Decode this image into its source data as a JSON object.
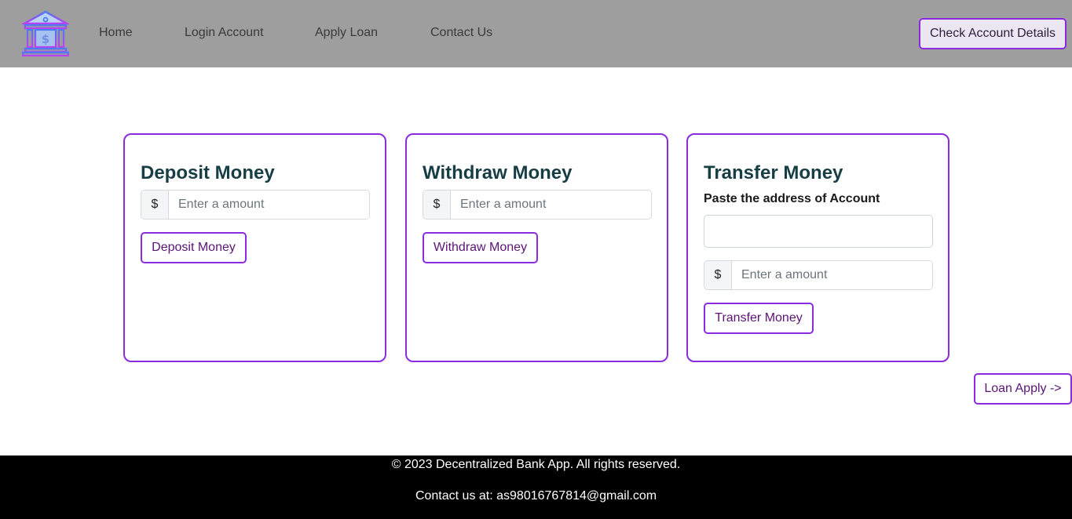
{
  "navbar": {
    "logo_icon": "bank-icon",
    "links": [
      "Home",
      "Login Account",
      "Apply Loan",
      "Contact Us"
    ],
    "check_button": "Check Account Details"
  },
  "deposit": {
    "title": "Deposit Money",
    "currency": "$",
    "placeholder": "Enter a amount",
    "button": "Deposit Money"
  },
  "withdraw": {
    "title": "Withdraw Money",
    "currency": "$",
    "placeholder": "Enter a amount",
    "button": "Withdraw Money"
  },
  "transfer": {
    "title": "Transfer Money",
    "address_label": "Paste the address of Account",
    "address_value": "",
    "currency": "$",
    "placeholder": "Enter a amount",
    "button": "Transfer Money"
  },
  "loan_button": "Loan Apply ->",
  "footer": {
    "copyright": "© 2023 Decentralized Bank App. All rights reserved.",
    "contact": "Contact us at: as98016767814@gmail.com"
  },
  "colors": {
    "accent": "#8a2be2",
    "navbar_bg": "#9e9e9e",
    "footer_bg": "#000000",
    "title_color": "#173d45"
  }
}
